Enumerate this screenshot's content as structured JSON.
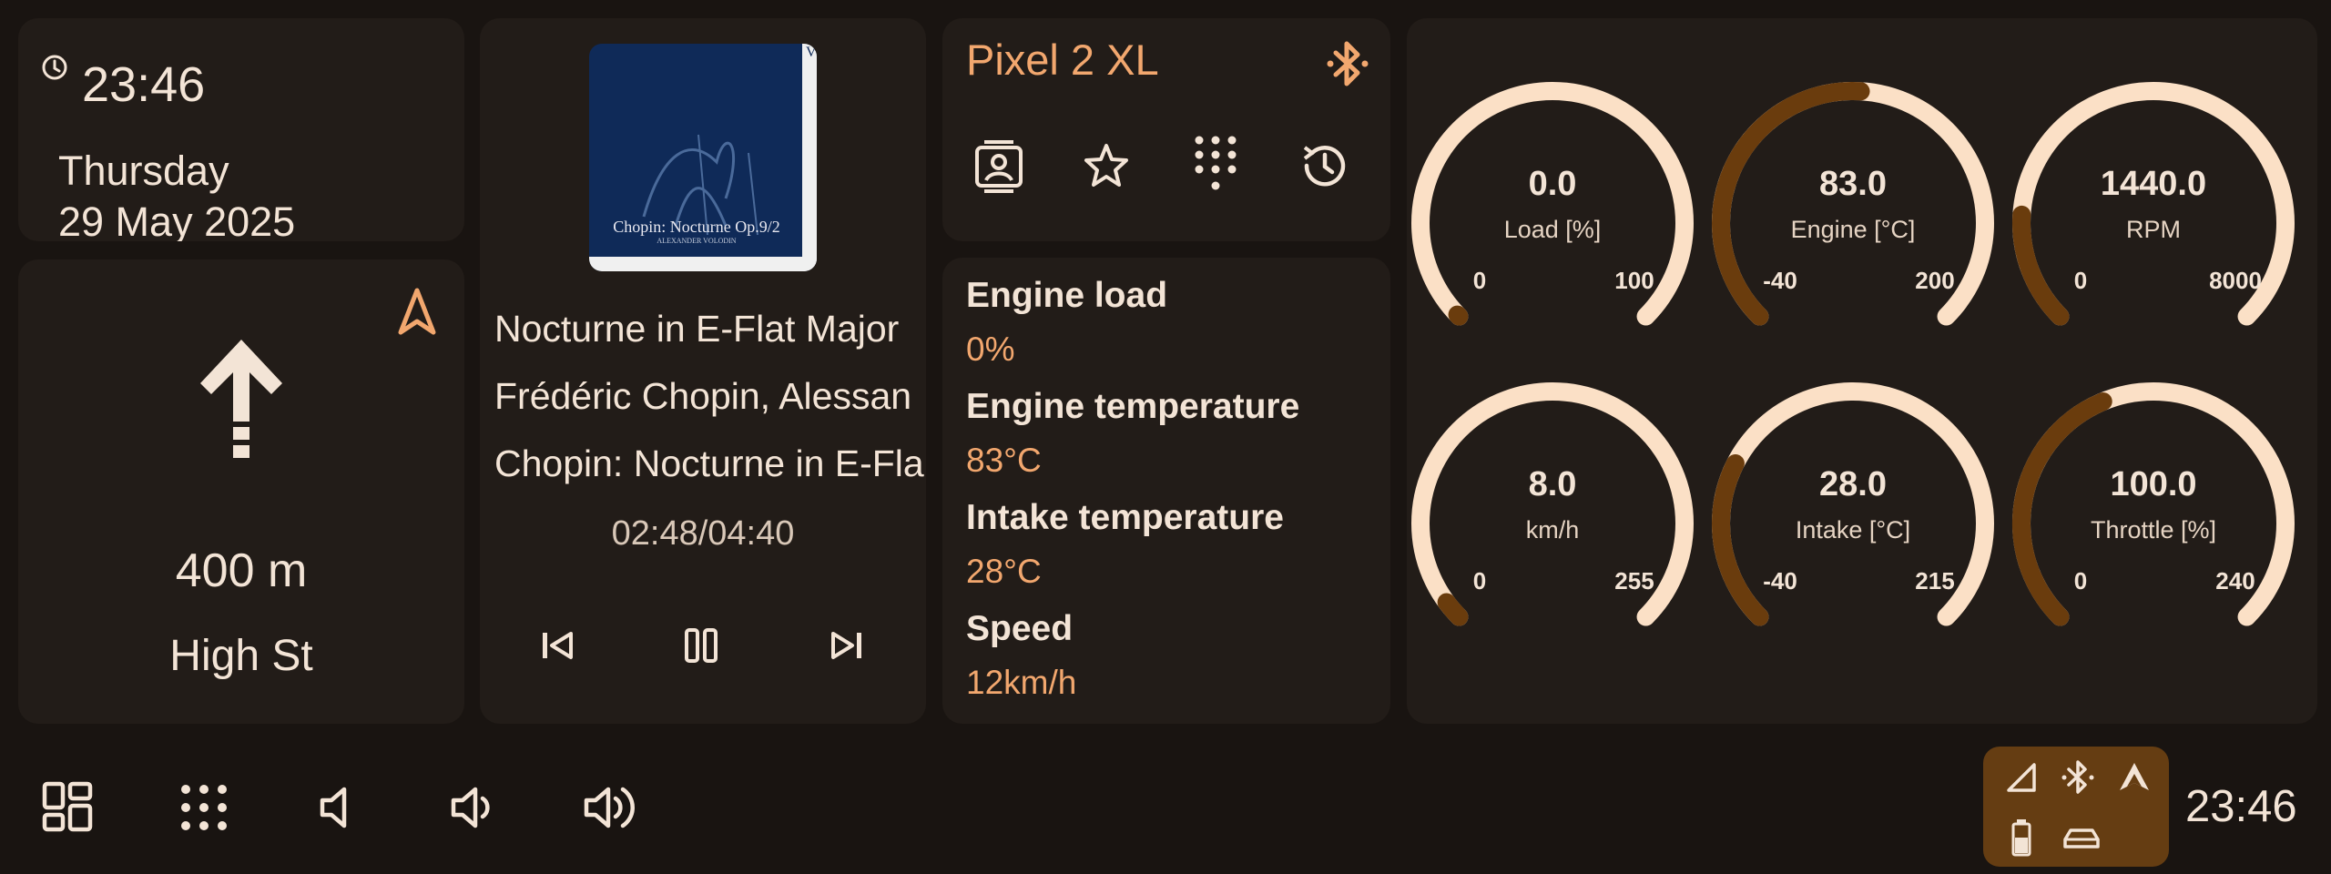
{
  "clock": {
    "time": "23:46",
    "day": "Thursday",
    "date": "29 May 2025"
  },
  "navigation": {
    "distance": "400 m",
    "street": "High St"
  },
  "media": {
    "album_art_text": "Chopin: Nocturne Op.9/2",
    "album_art_subtext": "ALEXANDER VOLODIN",
    "title": "Nocturne in E-Flat Major",
    "artist": "Frédéric Chopin, Alessan",
    "album": "Chopin: Nocturne in E-Fla",
    "time": "02:48/04:40"
  },
  "phone": {
    "device_name": "Pixel 2 XL",
    "actions": [
      "contacts",
      "favorites",
      "dialpad",
      "recent-calls"
    ]
  },
  "obd": [
    {
      "label": "Engine load",
      "value": "0%"
    },
    {
      "label": "Engine temperature",
      "value": "83°C"
    },
    {
      "label": "Intake temperature",
      "value": "28°C"
    },
    {
      "label": "Speed",
      "value": "12km/h"
    }
  ],
  "gauges": [
    {
      "value": "0.0",
      "name": "Load [%]",
      "min": "0",
      "max": "100",
      "fraction": 0.0
    },
    {
      "value": "83.0",
      "name": "Engine [°C]",
      "min": "-40",
      "max": "200",
      "fraction": 0.5125
    },
    {
      "value": "1440.0",
      "name": "RPM",
      "min": "0",
      "max": "8000",
      "fraction": 0.18
    },
    {
      "value": "8.0",
      "name": "km/h",
      "min": "0",
      "max": "255",
      "fraction": 0.031
    },
    {
      "value": "28.0",
      "name": "Intake [°C]",
      "min": "-40",
      "max": "215",
      "fraction": 0.267
    },
    {
      "value": "100.0",
      "name": "Throttle [%]",
      "min": "0",
      "max": "240",
      "fraction": 0.417
    }
  ],
  "bottom_bar": {
    "buttons": [
      "dashboard",
      "app-launcher",
      "volume-mute",
      "volume-down",
      "volume-up"
    ],
    "status_icons": [
      "cell-signal",
      "bluetooth",
      "android-auto",
      "battery",
      "car"
    ],
    "time": "23:46"
  },
  "colors": {
    "background": "#191411",
    "card": "#221c18",
    "accent": "#f2a76e",
    "gauge_track": "#fbe0c6",
    "gauge_fill": "#6a3c0d",
    "status_pill": "#653d12"
  }
}
